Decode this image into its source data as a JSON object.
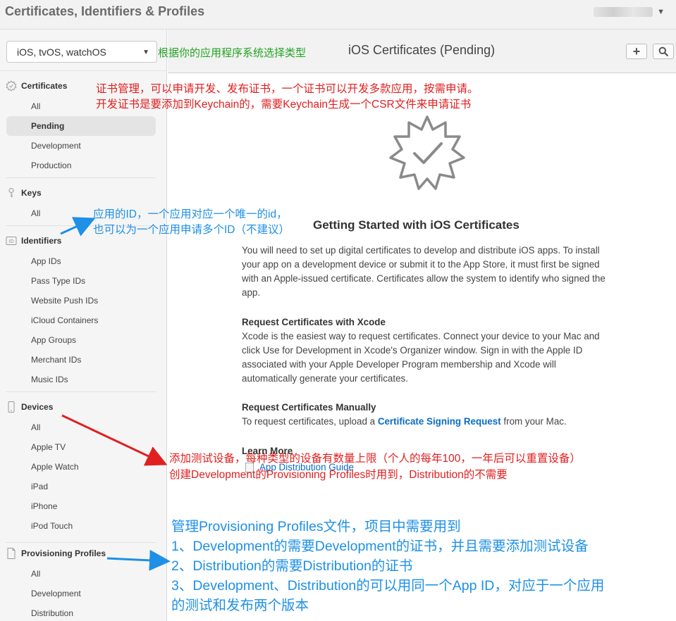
{
  "window": {
    "title": "Certificates, Identifiers & Profiles"
  },
  "account": {
    "caret_icon": "chevron-down-icon"
  },
  "sidebar": {
    "platform": {
      "selected": "iOS, tvOS, watchOS"
    },
    "sections": {
      "certificates": {
        "label": "Certificates",
        "icon": "badge-icon",
        "items": [
          "All",
          "Pending",
          "Development",
          "Production"
        ]
      },
      "keys": {
        "label": "Keys",
        "icon": "key-icon",
        "items": [
          "All"
        ]
      },
      "identifiers": {
        "label": "Identifiers",
        "icon": "id-icon",
        "items": [
          "App IDs",
          "Pass Type IDs",
          "Website Push IDs",
          "iCloud Containers",
          "App Groups",
          "Merchant IDs",
          "Music IDs"
        ]
      },
      "devices": {
        "label": "Devices",
        "icon": "phone-icon",
        "items": [
          "All",
          "Apple TV",
          "Apple Watch",
          "iPad",
          "iPhone",
          "iPod Touch"
        ]
      },
      "profiles": {
        "label": "Provisioning Profiles",
        "icon": "document-icon",
        "items": [
          "All",
          "Development",
          "Distribution"
        ]
      }
    }
  },
  "main": {
    "title": "iOS Certificates (Pending)",
    "buttons": {
      "add": "+"
    },
    "getting_started": {
      "title": "Getting Started with iOS Certificates",
      "intro": "You will need to set up digital certificates to develop and distribute iOS apps. To install your app on a development device or submit it to the App Store, it must first be signed with an Apple-issued certificate. Certificates allow the system to identify who signed the app.",
      "xcode_heading": "Request Certificates with Xcode",
      "xcode_body": "Xcode is the easiest way to request certificates. Connect your device to your Mac and click Use for Development in Xcode's Organizer window. Sign in with the Apple ID associated with your Apple Developer Program membership and Xcode will automatically generate your certificates.",
      "manual_heading": "Request Certificates Manually",
      "manual_body_prefix": "To request certificates, upload a",
      "manual_link": "Certificate Signing Request",
      "manual_body_suffix": "from your Mac.",
      "learn_more": "Learn More",
      "guide_link": "App Distribution Guide"
    }
  },
  "annotations": {
    "platform_note": "根据你的应用程序系统选择类型",
    "cert_note_1": "证书管理，可以申请开发、发布证书，一个证书可以开发多款应用，按需申请。",
    "cert_note_2": "开发证书是要添加到Keychain的，需要Keychain生成一个CSR文件来申请证书",
    "id_note_1": "应用的ID，一个应用对应一个唯一的id，",
    "id_note_2": "也可以为一个应用申请多个ID（不建议）",
    "device_note_1": "添加测试设备，每种类型的设备有数量上限（个人的每年100，一年后可以重置设备）",
    "device_note_2": "创建Development的Provisioning Profiles时用到，Distribution的不需要",
    "profile_note_1": "管理Provisioning Profiles文件，项目中需要用到",
    "profile_note_2": "1、Development的需要Development的证书，并且需要添加测试设备",
    "profile_note_3": "2、Distribution的需要Distribution的证书",
    "profile_note_4": "3、Development、Distribution的可以用同一个App ID，对应于一个应用",
    "profile_note_5": "的测试和发布两个版本"
  },
  "colors": {
    "annotation_red": "#e02020",
    "annotation_blue": "#1e90e6",
    "annotation_green": "#21a421",
    "link": "#0a6cc4"
  }
}
